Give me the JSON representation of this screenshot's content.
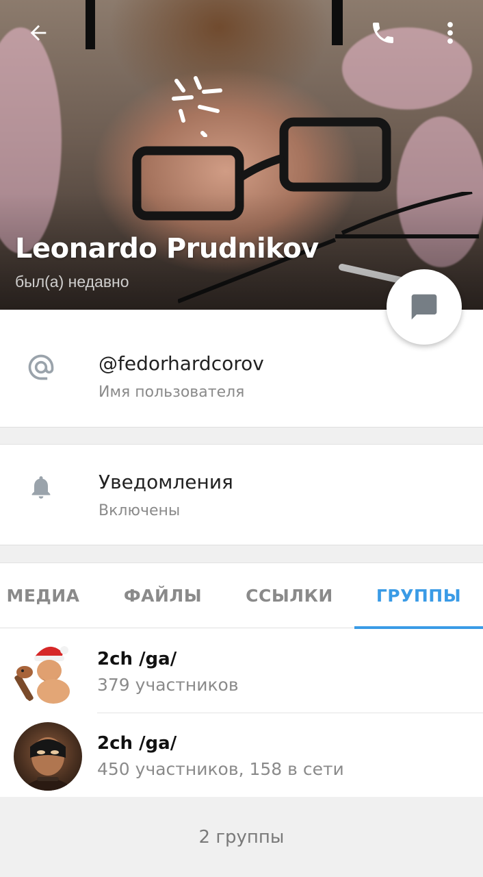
{
  "header": {
    "name": "Leonardo Prudnikov",
    "status": "был(а) недавно",
    "back_icon": "arrow-left-icon",
    "call_icon": "phone-icon",
    "more_icon": "more-vert-icon",
    "message_icon": "chat-bubble-icon"
  },
  "info": {
    "username": {
      "icon": "at-sign-icon",
      "value": "@fedorhardcorov",
      "label": "Имя пользователя"
    },
    "notifications": {
      "icon": "bell-icon",
      "value": "Уведомления",
      "label": "Включены"
    }
  },
  "tabs": [
    {
      "label": "МЕДИА",
      "active": false
    },
    {
      "label": "ФАЙЛЫ",
      "active": false
    },
    {
      "label": "ССЫЛКИ",
      "active": false
    },
    {
      "label": "ГРУППЫ",
      "active": true
    }
  ],
  "groups": [
    {
      "name": "2ch /ga/",
      "members": "379 участников"
    },
    {
      "name": "2ch /ga/",
      "members": "450 участников, 158 в сети"
    }
  ],
  "footer": {
    "count": "2 группы"
  },
  "colors": {
    "accent": "#3a9be6",
    "secondary_text": "#8a8a8a",
    "icon_gray": "#9aa3ab"
  }
}
